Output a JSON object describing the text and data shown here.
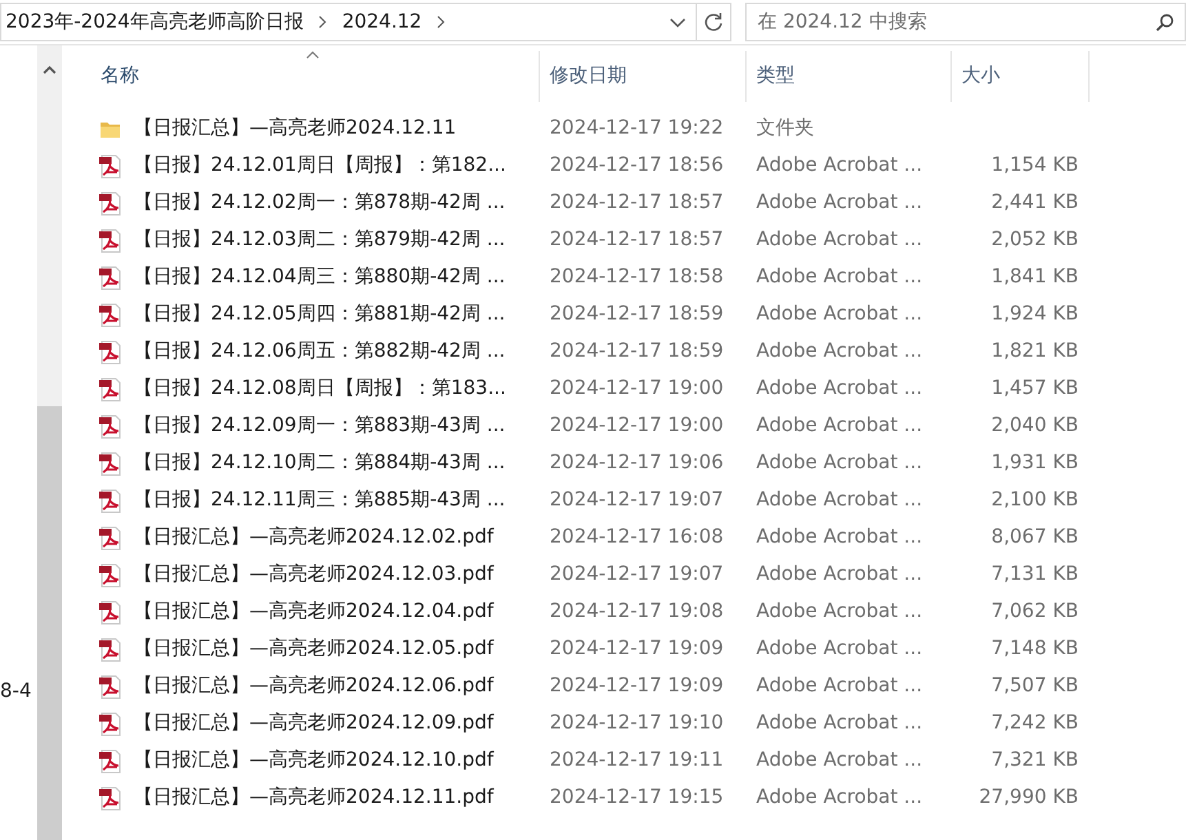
{
  "address_bar": {
    "path": [
      "2023年-2024年高亮老师高阶日报",
      "2024.12"
    ]
  },
  "search": {
    "placeholder": "在 2024.12 中搜索"
  },
  "navigation_pane": {
    "partial_label": "8-4"
  },
  "columns": [
    {
      "label": "名称",
      "sorted": true
    },
    {
      "label": "修改日期",
      "sorted": false
    },
    {
      "label": "类型",
      "sorted": false
    },
    {
      "label": "大小",
      "sorted": false
    }
  ],
  "files": [
    {
      "kind": "folder",
      "name": "【日报汇总】—高亮老师2024.12.11",
      "modified": "2024-12-17 19:22",
      "type": "文件夹"
    },
    {
      "kind": "pdf",
      "name": "【日报】24.12.01周日【周报】：第182...",
      "modified": "2024-12-17 18:56",
      "type": "Adobe Acrobat ...",
      "size": "1,154 KB"
    },
    {
      "kind": "pdf",
      "name": "【日报】24.12.02周一：第878期-42周 ...",
      "modified": "2024-12-17 18:57",
      "type": "Adobe Acrobat ...",
      "size": "2,441 KB"
    },
    {
      "kind": "pdf",
      "name": "【日报】24.12.03周二：第879期-42周 ...",
      "modified": "2024-12-17 18:57",
      "type": "Adobe Acrobat ...",
      "size": "2,052 KB"
    },
    {
      "kind": "pdf",
      "name": "【日报】24.12.04周三：第880期-42周 ...",
      "modified": "2024-12-17 18:58",
      "type": "Adobe Acrobat ...",
      "size": "1,841 KB"
    },
    {
      "kind": "pdf",
      "name": "【日报】24.12.05周四：第881期-42周 ...",
      "modified": "2024-12-17 18:59",
      "type": "Adobe Acrobat ...",
      "size": "1,924 KB"
    },
    {
      "kind": "pdf",
      "name": "【日报】24.12.06周五：第882期-42周 ...",
      "modified": "2024-12-17 18:59",
      "type": "Adobe Acrobat ...",
      "size": "1,821 KB"
    },
    {
      "kind": "pdf",
      "name": "【日报】24.12.08周日【周报】：第183...",
      "modified": "2024-12-17 19:00",
      "type": "Adobe Acrobat ...",
      "size": "1,457 KB"
    },
    {
      "kind": "pdf",
      "name": "【日报】24.12.09周一：第883期-43周 ...",
      "modified": "2024-12-17 19:00",
      "type": "Adobe Acrobat ...",
      "size": "2,040 KB"
    },
    {
      "kind": "pdf",
      "name": "【日报】24.12.10周二：第884期-43周 ...",
      "modified": "2024-12-17 19:06",
      "type": "Adobe Acrobat ...",
      "size": "1,931 KB"
    },
    {
      "kind": "pdf",
      "name": "【日报】24.12.11周三：第885期-43周 ...",
      "modified": "2024-12-17 19:07",
      "type": "Adobe Acrobat ...",
      "size": "2,100 KB"
    },
    {
      "kind": "pdf",
      "name": "【日报汇总】—高亮老师2024.12.02.pdf",
      "modified": "2024-12-17 16:08",
      "type": "Adobe Acrobat ...",
      "size": "8,067 KB"
    },
    {
      "kind": "pdf",
      "name": "【日报汇总】—高亮老师2024.12.03.pdf",
      "modified": "2024-12-17 19:07",
      "type": "Adobe Acrobat ...",
      "size": "7,131 KB"
    },
    {
      "kind": "pdf",
      "name": "【日报汇总】—高亮老师2024.12.04.pdf",
      "modified": "2024-12-17 19:08",
      "type": "Adobe Acrobat ...",
      "size": "7,062 KB"
    },
    {
      "kind": "pdf",
      "name": "【日报汇总】—高亮老师2024.12.05.pdf",
      "modified": "2024-12-17 19:09",
      "type": "Adobe Acrobat ...",
      "size": "7,148 KB"
    },
    {
      "kind": "pdf",
      "name": "【日报汇总】—高亮老师2024.12.06.pdf",
      "modified": "2024-12-17 19:09",
      "type": "Adobe Acrobat ...",
      "size": "7,507 KB"
    },
    {
      "kind": "pdf",
      "name": "【日报汇总】—高亮老师2024.12.09.pdf",
      "modified": "2024-12-17 19:10",
      "type": "Adobe Acrobat ...",
      "size": "7,242 KB"
    },
    {
      "kind": "pdf",
      "name": "【日报汇总】—高亮老师2024.12.10.pdf",
      "modified": "2024-12-17 19:11",
      "type": "Adobe Acrobat ...",
      "size": "7,321 KB"
    },
    {
      "kind": "pdf",
      "name": "【日报汇总】—高亮老师2024.12.11.pdf",
      "modified": "2024-12-17 19:15",
      "type": "Adobe Acrobat ...",
      "size": "27,990 KB"
    }
  ]
}
